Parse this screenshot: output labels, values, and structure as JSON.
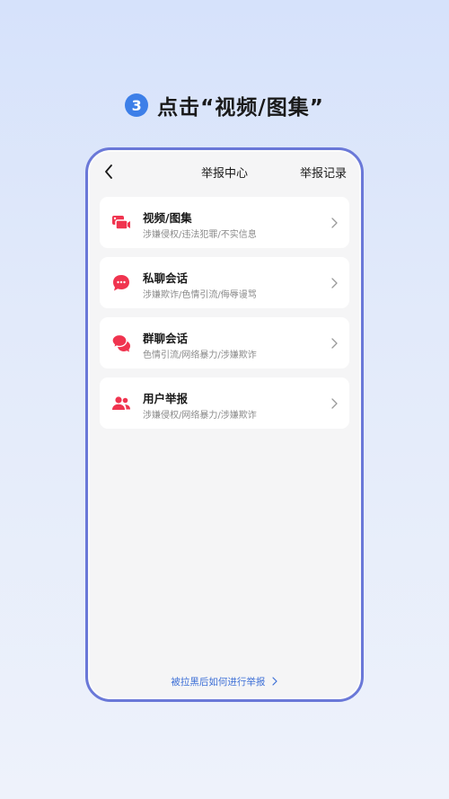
{
  "step": {
    "number": "3",
    "text": "点击“视频/图集”"
  },
  "nav": {
    "title": "举报中心",
    "right_action": "举报记录"
  },
  "items": [
    {
      "title": "视频/图集",
      "subtitle": "涉嫌侵权/违法犯罪/不实信息",
      "icon": "video-gallery-icon"
    },
    {
      "title": "私聊会话",
      "subtitle": "涉嫌欺诈/色情引流/侮辱谩骂",
      "icon": "private-chat-icon"
    },
    {
      "title": "群聊会话",
      "subtitle": "色情引流/网络暴力/涉嫌欺诈",
      "icon": "group-chat-icon"
    },
    {
      "title": "用户举报",
      "subtitle": "涉嫌侵权/网络暴力/涉嫌欺诈",
      "icon": "users-icon"
    }
  ],
  "footer": {
    "link": "被拉黑后如何进行举报"
  },
  "colors": {
    "accent": "#f0344f",
    "step_badge": "#3d7fe8",
    "link": "#3d6fd6",
    "frame": "#6a78d8"
  }
}
